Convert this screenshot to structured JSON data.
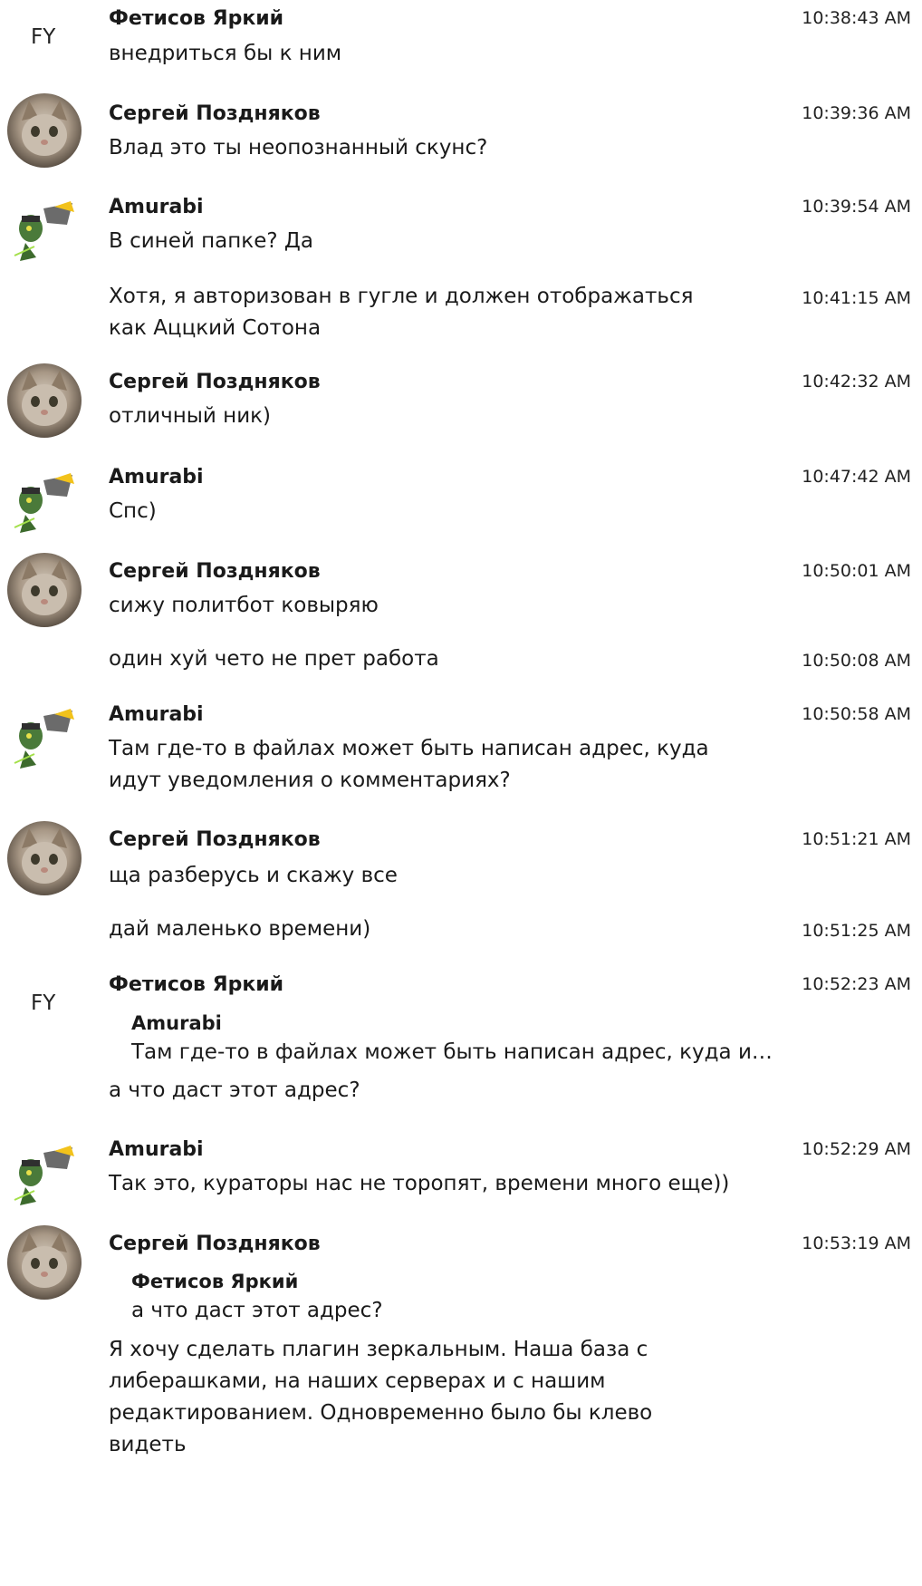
{
  "messages": [
    {
      "author": "Фетисов Яркий",
      "initials": "FY",
      "text": "внедриться бы к ним",
      "time": "10:38:43 AM"
    },
    {
      "author": "Сергей Поздняков",
      "text": "Влад это ты неопознанный скунс?",
      "time": "10:39:36 AM"
    },
    {
      "author": "Amurabi",
      "text": "В синей папке? Да",
      "time": "10:39:54 AM"
    },
    {
      "text": "Хотя, я авторизован в гугле и должен отображаться как Аццкий Сотона",
      "time": "10:41:15 AM"
    },
    {
      "author": "Сергей Поздняков",
      "text": "отличный ник)",
      "time": "10:42:32 AM"
    },
    {
      "author": "Amurabi",
      "text": "Спс)",
      "time": "10:47:42 AM"
    },
    {
      "author": "Сергей Поздняков",
      "text": "сижу политбот ковыряю",
      "time": "10:50:01 AM"
    },
    {
      "text": "один хуй чето не прет работа",
      "time": "10:50:08 AM"
    },
    {
      "author": "Amurabi",
      "text": "Там где-то в файлах может быть написан адрес, куда идут уведомления о комментариях?",
      "time": "10:50:58 AM"
    },
    {
      "author": "Сергей Поздняков",
      "text": "ща разберусь и скажу все",
      "time": "10:51:21 AM"
    },
    {
      "text": "дай маленько времени)",
      "time": "10:51:25 AM"
    },
    {
      "author": "Фетисов Яркий",
      "initials": "FY",
      "quote_author": "Amurabi",
      "quote_text": "Там где-то в файлах может быть написан адрес, куда иду…",
      "text": "а что даст этот адрес?",
      "time": "10:52:23 AM"
    },
    {
      "author": "Amurabi",
      "text": "Так это, кураторы нас не торопят, времени много еще))",
      "time": "10:52:29 AM"
    },
    {
      "author": "Сергей Поздняков",
      "quote_author": "Фетисов Яркий",
      "quote_text": "а что даст этот адрес?",
      "text": "Я хочу сделать плагин зеркальным. Наша база с либерашками, на наших серверах и с нашим редактированием. Одновременно было бы клево видеть",
      "time": "10:53:19 AM"
    }
  ]
}
